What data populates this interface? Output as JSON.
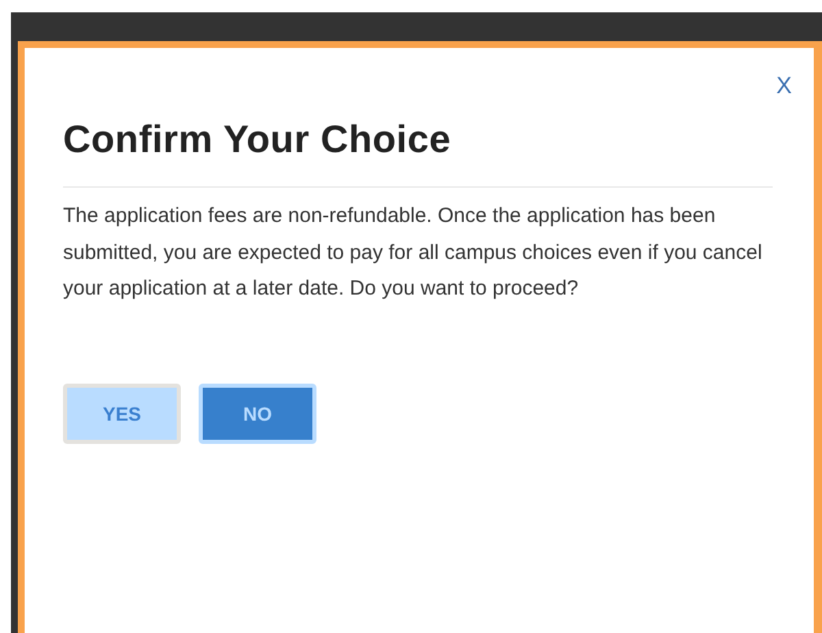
{
  "dialog": {
    "close": "X",
    "title": "Confirm Your Choice",
    "message": "The application fees are non-refundable. Once the application has been submitted, you are expected to pay for all campus choices even if you cancel your application at a later date. Do you want to proceed?",
    "buttons": [
      {
        "label": "YES",
        "kind": "secondary"
      },
      {
        "label": "NO",
        "kind": "primary"
      }
    ]
  }
}
